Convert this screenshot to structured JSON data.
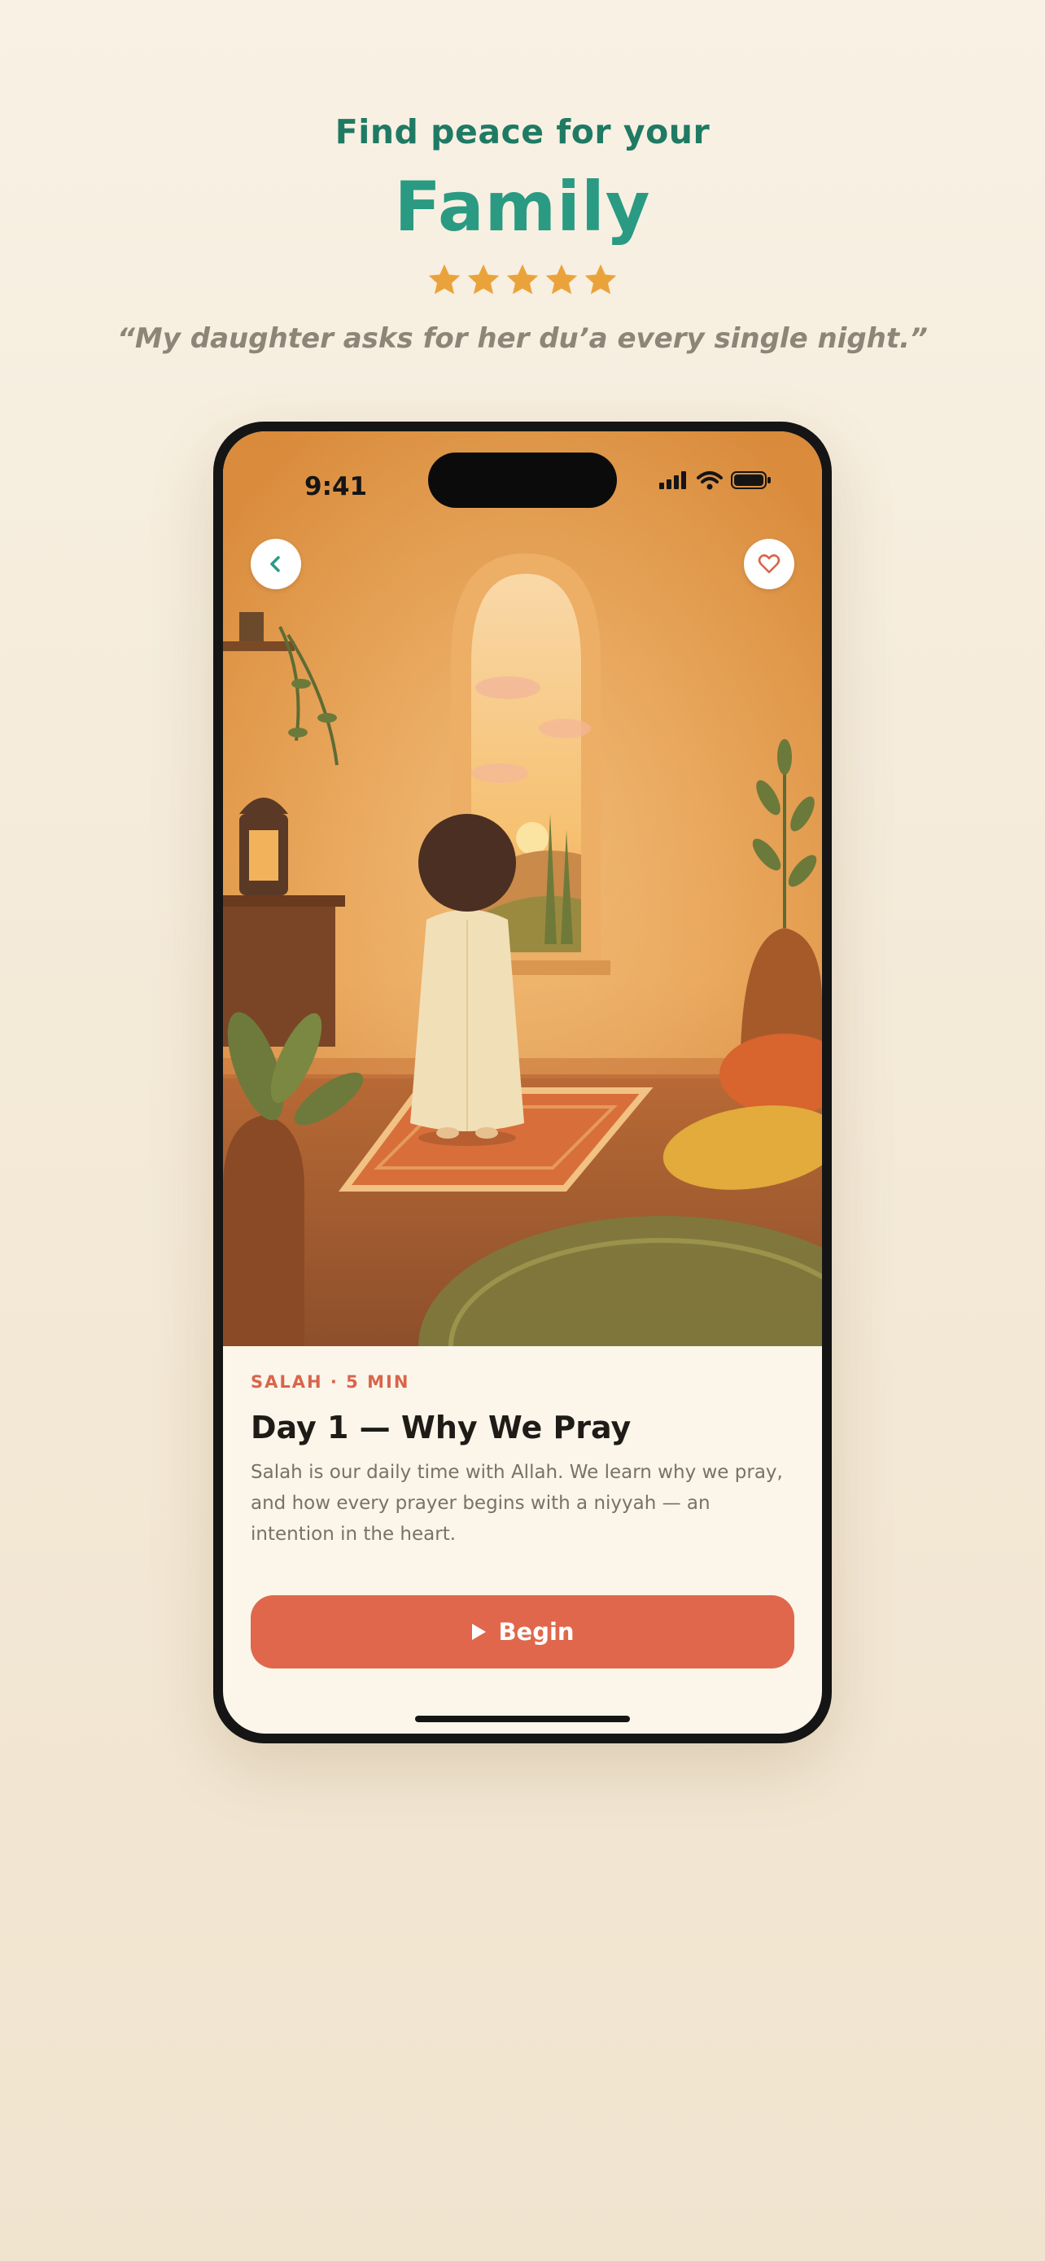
{
  "header": {
    "line1": "Find peace for your",
    "line2": "Family",
    "rating_stars": 5,
    "quote": "“My daughter asks for her du’a every single night.”"
  },
  "colors": {
    "brand_green": "#2a9a83",
    "accent": "#e0674b",
    "star": "#eaa33b"
  },
  "status_bar": {
    "time": "9:41"
  },
  "lesson": {
    "category": "SALAH · 5 MIN",
    "title": "Day 1 — Why We Pray",
    "description": "Salah is our daily time with Allah. We learn why we pray, and how every prayer begins with a niyyah — an intention in the heart.",
    "cta_label": "Begin"
  },
  "icons": {
    "back": "chevron-left-icon",
    "favorite": "heart-icon",
    "cta": "play-icon"
  }
}
